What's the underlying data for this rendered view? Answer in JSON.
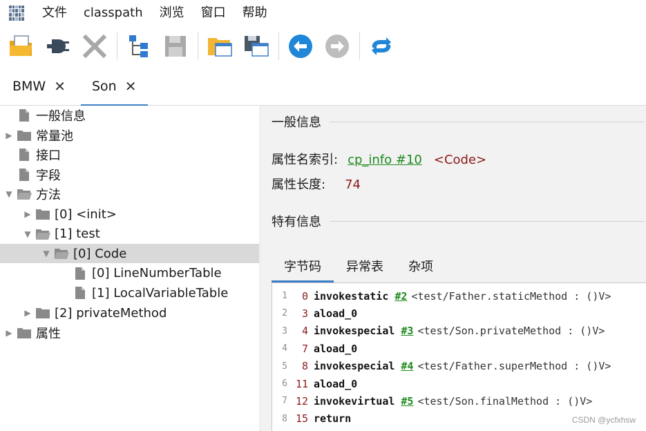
{
  "menubar": {
    "items": [
      {
        "label": "文件"
      },
      {
        "label": "classpath"
      },
      {
        "label": "浏览"
      },
      {
        "label": "窗口"
      },
      {
        "label": "帮助"
      }
    ]
  },
  "toolbar": {
    "buttons": [
      {
        "icon": "open-folder-icon",
        "enabled": true
      },
      {
        "icon": "plug-icon",
        "enabled": true
      },
      {
        "icon": "close-x-icon",
        "enabled": false
      },
      {
        "icon": "tree-hierarchy-icon",
        "enabled": true
      },
      {
        "icon": "save-disk-icon",
        "enabled": false
      },
      {
        "icon": "folder-window-icon",
        "enabled": true
      },
      {
        "icon": "save-window-icon",
        "enabled": true
      },
      {
        "icon": "back-arrow-icon",
        "enabled": true
      },
      {
        "icon": "forward-arrow-icon",
        "enabled": false
      },
      {
        "icon": "sync-icon",
        "enabled": true
      }
    ]
  },
  "tabs": [
    {
      "label": "BMW",
      "close": "✕",
      "active": false
    },
    {
      "label": "Son",
      "close": "✕",
      "active": true
    }
  ],
  "tree": [
    {
      "label": "一般信息",
      "icon": "file-icon",
      "arrow": ""
    },
    {
      "label": "常量池",
      "icon": "folder-icon",
      "arrow": "▶"
    },
    {
      "label": "接口",
      "icon": "file-icon",
      "arrow": ""
    },
    {
      "label": "字段",
      "icon": "file-icon",
      "arrow": ""
    },
    {
      "label": "方法",
      "icon": "folder-open-icon",
      "arrow": "▼"
    },
    {
      "label": "[0] <init>",
      "icon": "folder-icon",
      "arrow": "▶"
    },
    {
      "label": "[1] test",
      "icon": "folder-open-icon",
      "arrow": "▼"
    },
    {
      "label": "[0] Code",
      "icon": "folder-open-icon",
      "arrow": "▼",
      "selected": true
    },
    {
      "label": "[0] LineNumberTable",
      "icon": "file-icon",
      "arrow": ""
    },
    {
      "label": "[1] LocalVariableTable",
      "icon": "file-icon",
      "arrow": ""
    },
    {
      "label": "[2] privateMethod",
      "icon": "folder-icon",
      "arrow": "▶"
    },
    {
      "label": "属性",
      "icon": "folder-icon",
      "arrow": "▶"
    }
  ],
  "detail": {
    "general_title": "一般信息",
    "attr_name_index_label": "属性名索引:",
    "attr_name_index_link": "cp_info #10",
    "attr_name_index_value": "<Code>",
    "attr_length_label": "属性长度:",
    "attr_length_value": "74",
    "specific_title": "特有信息",
    "subtabs": [
      {
        "label": "字节码",
        "active": true
      },
      {
        "label": "异常表",
        "active": false
      },
      {
        "label": "杂项",
        "active": false
      }
    ]
  },
  "bytecode": [
    {
      "line": "1",
      "offset": "0",
      "op": "invokestatic",
      "ref": "#2",
      "desc": "<test/Father.staticMethod : ()V>"
    },
    {
      "line": "2",
      "offset": "3",
      "op": "aload_0",
      "ref": "",
      "desc": ""
    },
    {
      "line": "3",
      "offset": "4",
      "op": "invokespecial",
      "ref": "#3",
      "desc": "<test/Son.privateMethod : ()V>"
    },
    {
      "line": "4",
      "offset": "7",
      "op": "aload_0",
      "ref": "",
      "desc": ""
    },
    {
      "line": "5",
      "offset": "8",
      "op": "invokespecial",
      "ref": "#4",
      "desc": "<test/Father.superMethod : ()V>"
    },
    {
      "line": "6",
      "offset": "11",
      "op": "aload_0",
      "ref": "",
      "desc": ""
    },
    {
      "line": "7",
      "offset": "12",
      "op": "invokevirtual",
      "ref": "#5",
      "desc": "<test/Son.finalMethod : ()V>"
    },
    {
      "line": "8",
      "offset": "15",
      "op": "return",
      "ref": "",
      "desc": ""
    }
  ],
  "watermark": "CSDN @ycfxhsw",
  "colors": {
    "accent": "#3d7fc8",
    "link": "#1e8a1e",
    "value": "#8b1a1a",
    "selection": "#d9d9d9"
  }
}
